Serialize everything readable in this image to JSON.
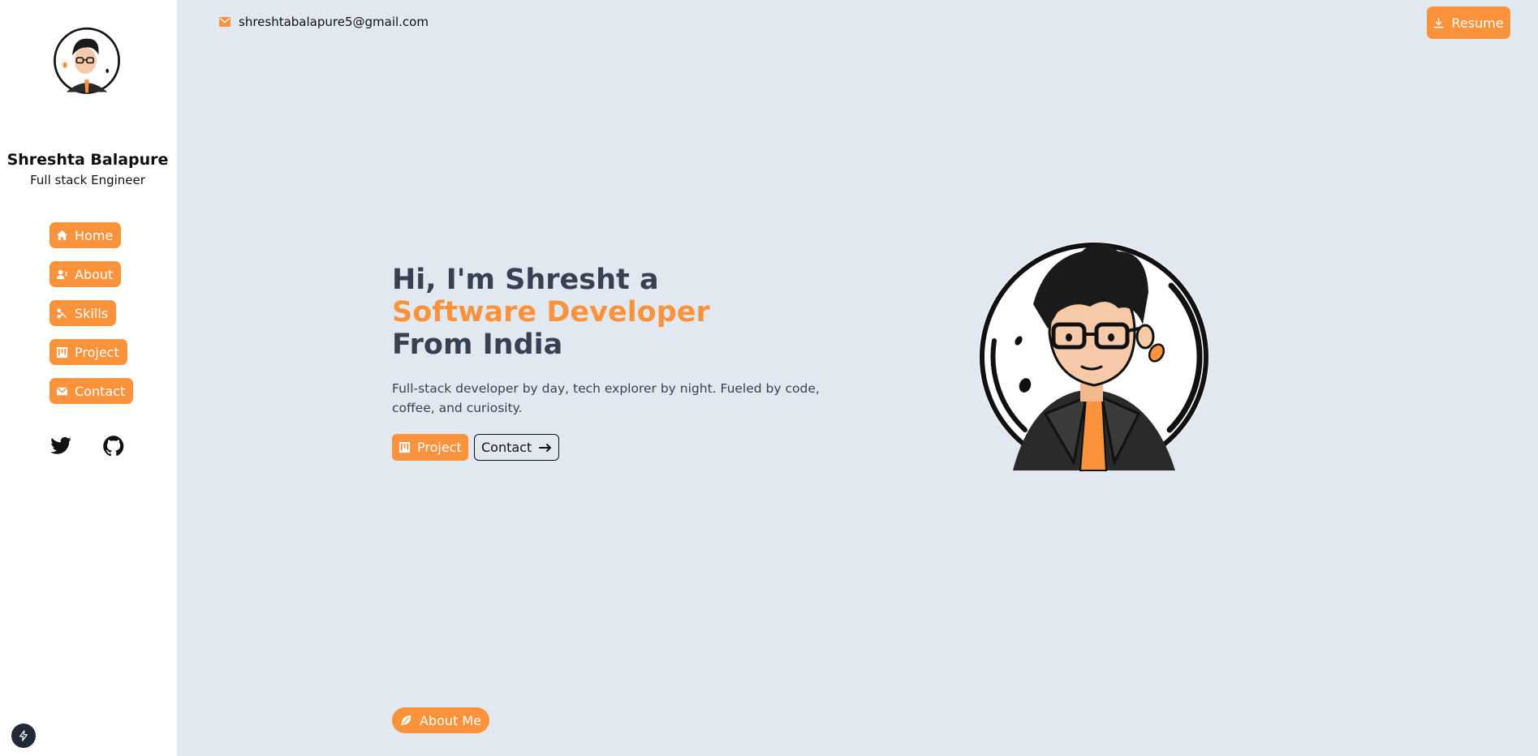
{
  "sidebar": {
    "name": "Shreshta Balapure",
    "role": "Full stack Engineer",
    "nav": [
      {
        "label": "Home",
        "icon": "home-icon"
      },
      {
        "label": "About",
        "icon": "user-card-icon"
      },
      {
        "label": "Skills",
        "icon": "skills-icon"
      },
      {
        "label": "Project",
        "icon": "kanban-icon"
      },
      {
        "label": "Contact",
        "icon": "mail-icon"
      }
    ],
    "social": [
      "twitter-icon",
      "github-icon"
    ]
  },
  "topbar": {
    "email": "shreshtabalapure5@gmail.com",
    "resume_label": "Resume"
  },
  "hero": {
    "line1": "Hi, I'm Shresht a",
    "line2": "Software Developer",
    "line3": "From India",
    "description": "Full-stack developer by day, tech explorer by night. Fueled by code, coffee, and curiosity.",
    "project_label": "Project",
    "contact_label": "Contact"
  },
  "about_me_label": "About Me",
  "colors": {
    "accent": "#fb923c",
    "background": "#e2e8f0",
    "sidebar": "#ffffff",
    "heading": "#374151"
  }
}
